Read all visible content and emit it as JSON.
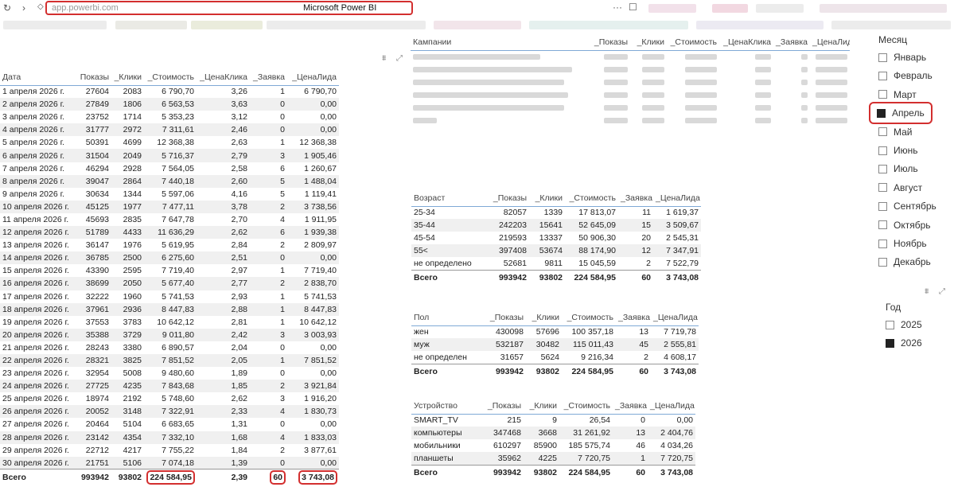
{
  "browser": {
    "url": "app.powerbi.com",
    "title": "Microsoft Power BI",
    "more_icon": "···"
  },
  "daily_table": {
    "headers": [
      "Дата",
      "Показы",
      "_Клики",
      "_Стоимость",
      "_ЦенаКлика",
      "_Заявка",
      "_ЦенаЛида"
    ],
    "rows": [
      [
        "1 апреля 2026 г.",
        "27604",
        "2083",
        "6 790,70",
        "3,26",
        "1",
        "6 790,70"
      ],
      [
        "2 апреля 2026 г.",
        "27849",
        "1806",
        "6 563,53",
        "3,63",
        "0",
        "0,00"
      ],
      [
        "3 апреля 2026 г.",
        "23752",
        "1714",
        "5 353,23",
        "3,12",
        "0",
        "0,00"
      ],
      [
        "4 апреля 2026 г.",
        "31777",
        "2972",
        "7 311,61",
        "2,46",
        "0",
        "0,00"
      ],
      [
        "5 апреля 2026 г.",
        "50391",
        "4699",
        "12 368,38",
        "2,63",
        "1",
        "12 368,38"
      ],
      [
        "6 апреля 2026 г.",
        "31504",
        "2049",
        "5 716,37",
        "2,79",
        "3",
        "1 905,46"
      ],
      [
        "7 апреля 2026 г.",
        "46294",
        "2928",
        "7 564,05",
        "2,58",
        "6",
        "1 260,67"
      ],
      [
        "8 апреля 2026 г.",
        "39047",
        "2864",
        "7 440,18",
        "2,60",
        "5",
        "1 488,04"
      ],
      [
        "9 апреля 2026 г.",
        "30634",
        "1344",
        "5 597,06",
        "4,16",
        "5",
        "1 119,41"
      ],
      [
        "10 апреля 2026 г.",
        "45125",
        "1977",
        "7 477,11",
        "3,78",
        "2",
        "3 738,56"
      ],
      [
        "11 апреля 2026 г.",
        "45693",
        "2835",
        "7 647,78",
        "2,70",
        "4",
        "1 911,95"
      ],
      [
        "12 апреля 2026 г.",
        "51789",
        "4433",
        "11 636,29",
        "2,62",
        "6",
        "1 939,38"
      ],
      [
        "13 апреля 2026 г.",
        "36147",
        "1976",
        "5 619,95",
        "2,84",
        "2",
        "2 809,97"
      ],
      [
        "14 апреля 2026 г.",
        "36785",
        "2500",
        "6 275,60",
        "2,51",
        "0",
        "0,00"
      ],
      [
        "15 апреля 2026 г.",
        "43390",
        "2595",
        "7 719,40",
        "2,97",
        "1",
        "7 719,40"
      ],
      [
        "16 апреля 2026 г.",
        "38699",
        "2050",
        "5 677,40",
        "2,77",
        "2",
        "2 838,70"
      ],
      [
        "17 апреля 2026 г.",
        "32222",
        "1960",
        "5 741,53",
        "2,93",
        "1",
        "5 741,53"
      ],
      [
        "18 апреля 2026 г.",
        "37961",
        "2936",
        "8 447,83",
        "2,88",
        "1",
        "8 447,83"
      ],
      [
        "19 апреля 2026 г.",
        "37553",
        "3783",
        "10 642,12",
        "2,81",
        "1",
        "10 642,12"
      ],
      [
        "20 апреля 2026 г.",
        "35388",
        "3729",
        "9 011,80",
        "2,42",
        "3",
        "3 003,93"
      ],
      [
        "21 апреля 2026 г.",
        "28243",
        "3380",
        "6 890,57",
        "2,04",
        "0",
        "0,00"
      ],
      [
        "22 апреля 2026 г.",
        "28321",
        "3825",
        "7 851,52",
        "2,05",
        "1",
        "7 851,52"
      ],
      [
        "23 апреля 2026 г.",
        "32954",
        "5008",
        "9 480,60",
        "1,89",
        "0",
        "0,00"
      ],
      [
        "24 апреля 2026 г.",
        "27725",
        "4235",
        "7 843,68",
        "1,85",
        "2",
        "3 921,84"
      ],
      [
        "25 апреля 2026 г.",
        "18974",
        "2192",
        "5 748,60",
        "2,62",
        "3",
        "1 916,20"
      ],
      [
        "26 апреля 2026 г.",
        "20052",
        "3148",
        "7 322,91",
        "2,33",
        "4",
        "1 830,73"
      ],
      [
        "27 апреля 2026 г.",
        "20464",
        "5104",
        "6 683,65",
        "1,31",
        "0",
        "0,00"
      ],
      [
        "28 апреля 2026 г.",
        "23142",
        "4354",
        "7 332,10",
        "1,68",
        "4",
        "1 833,03"
      ],
      [
        "29 апреля 2026 г.",
        "22712",
        "4217",
        "7 755,22",
        "1,84",
        "2",
        "3 877,61"
      ],
      [
        "30 апреля 2026 г.",
        "21751",
        "5106",
        "7 074,18",
        "1,39",
        "0",
        "0,00"
      ]
    ],
    "total": [
      "Всего",
      "993942",
      "93802",
      "224 584,95",
      "2,39",
      "60",
      "3 743,08"
    ]
  },
  "campaigns_table": {
    "headers": [
      "Кампании",
      "_Показы",
      "_Клики",
      "_Стоимость",
      "_ЦенаКлика",
      "_Заявка",
      "_ЦенаЛида"
    ]
  },
  "age_table": {
    "headers": [
      "Возраст",
      "_Показы",
      "_Клики",
      "_Стоимость",
      "_Заявка",
      "_ЦенаЛида"
    ],
    "rows": [
      [
        "25-34",
        "82057",
        "1339",
        "17 813,07",
        "11",
        "1 619,37"
      ],
      [
        "35-44",
        "242203",
        "15641",
        "52 645,09",
        "15",
        "3 509,67"
      ],
      [
        "45-54",
        "219593",
        "13337",
        "50 906,30",
        "20",
        "2 545,31"
      ],
      [
        "55<",
        "397408",
        "53674",
        "88 174,90",
        "12",
        "7 347,91"
      ],
      [
        "не определено",
        "52681",
        "9811",
        "15 045,59",
        "2",
        "7 522,79"
      ]
    ],
    "total": [
      "Всего",
      "993942",
      "93802",
      "224 584,95",
      "60",
      "3 743,08"
    ]
  },
  "gender_table": {
    "headers": [
      "Пол",
      "_Показы",
      "_Клики",
      "_Стоимость",
      "_Заявка",
      "_ЦенаЛида"
    ],
    "rows": [
      [
        "жен",
        "430098",
        "57696",
        "100 357,18",
        "13",
        "7 719,78"
      ],
      [
        "муж",
        "532187",
        "30482",
        "115 011,43",
        "45",
        "2 555,81"
      ],
      [
        "не определен",
        "31657",
        "5624",
        "9 216,34",
        "2",
        "4 608,17"
      ]
    ],
    "total": [
      "Всего",
      "993942",
      "93802",
      "224 584,95",
      "60",
      "3 743,08"
    ]
  },
  "device_table": {
    "headers": [
      "Устройство",
      "_Показы",
      "_Клики",
      "_Стоимость",
      "_Заявка",
      "_ЦенаЛида"
    ],
    "rows": [
      [
        "SMART_TV",
        "215",
        "9",
        "26,54",
        "0",
        "0,00"
      ],
      [
        "компьютеры",
        "347468",
        "3668",
        "31 261,92",
        "13",
        "2 404,76"
      ],
      [
        "мобильники",
        "610297",
        "85900",
        "185 575,74",
        "46",
        "4 034,26"
      ],
      [
        "планшеты",
        "35962",
        "4225",
        "7 720,75",
        "1",
        "7 720,75"
      ]
    ],
    "total": [
      "Всего",
      "993942",
      "93802",
      "224 584,95",
      "60",
      "3 743,08"
    ]
  },
  "month_slicer": {
    "title": "Месяц",
    "items": [
      "Январь",
      "Февраль",
      "Март",
      "Апрель",
      "Май",
      "Июнь",
      "Июль",
      "Август",
      "Сентябрь",
      "Октябрь",
      "Ноябрь",
      "Декабрь"
    ],
    "selected": "Апрель"
  },
  "year_slicer": {
    "title": "Год",
    "items": [
      "2025",
      "2026"
    ],
    "selected": "2026"
  },
  "icons": {
    "filter": "filter-icon",
    "focus": "focus-mode-icon",
    "back": "back-icon",
    "refresh": "refresh-icon",
    "shield": "shield-icon",
    "bookmark": "bookmark-icon"
  },
  "colors": {
    "highlight": "#d32f2f",
    "header_rule": "#7fa9d6",
    "row_alt": "#f0f0f0"
  }
}
